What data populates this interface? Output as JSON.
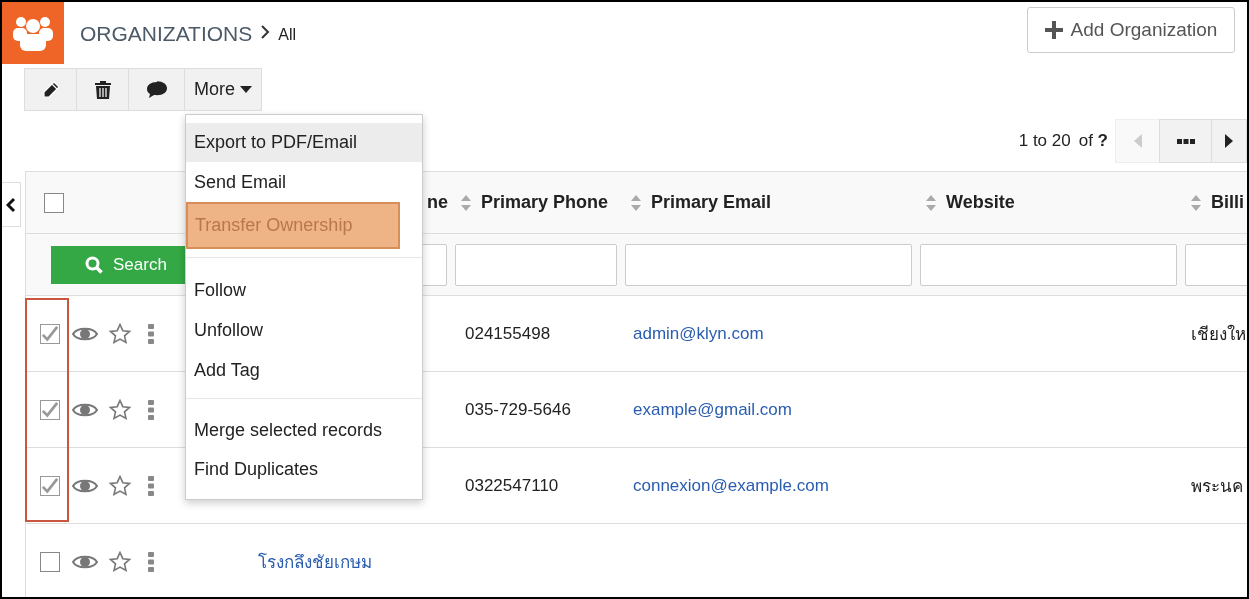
{
  "header": {
    "title": "ORGANIZATIONS",
    "breadcrumb": "All",
    "add_button": "Add Organization"
  },
  "toolbar": {
    "more": "More"
  },
  "pagination": {
    "range": "1 to 20",
    "of": "of",
    "total": "?",
    "prev_disabled": true
  },
  "table": {
    "all_selected": false,
    "columns": [
      {
        "kind": "select"
      },
      {
        "label": "ne",
        "kind": "partial"
      },
      {
        "label": "Primary Phone",
        "kind": "sortable"
      },
      {
        "label": "Primary Email",
        "kind": "sortable"
      },
      {
        "label": "Website",
        "kind": "sortable"
      },
      {
        "label": "Billi",
        "kind": "sortable"
      }
    ],
    "search_button": "Search",
    "rows": [
      {
        "checked": true,
        "name": "",
        "phone": "024155498",
        "email": "admin@klyn.com",
        "website": "",
        "billing": "เชียงให"
      },
      {
        "checked": true,
        "name": "",
        "phone": "035-729-5646",
        "email": "example@gmail.com",
        "website": "",
        "billing": ""
      },
      {
        "checked": true,
        "name": "",
        "phone": "0322547110",
        "email": "connexion@example.com",
        "website": "",
        "billing": "พระนค"
      },
      {
        "checked": false,
        "name": "โรงกลึงชัยเกษม",
        "phone": "",
        "email": "",
        "website": "",
        "billing": ""
      }
    ]
  },
  "menu": {
    "groups": [
      [
        {
          "label": "Export to PDF/Email",
          "hovered": true,
          "highlighted": false
        },
        {
          "label": "Send Email",
          "hovered": false,
          "highlighted": false
        },
        {
          "label": "Transfer Ownership",
          "hovered": false,
          "highlighted": true
        }
      ],
      [
        {
          "label": "Follow",
          "hovered": false,
          "highlighted": false
        },
        {
          "label": "Unfollow",
          "hovered": false,
          "highlighted": false
        },
        {
          "label": "Add Tag",
          "hovered": false,
          "highlighted": false
        }
      ],
      [
        {
          "label": "Merge selected records",
          "hovered": false,
          "highlighted": false
        },
        {
          "label": "Find Duplicates",
          "hovered": false,
          "highlighted": false
        }
      ]
    ]
  }
}
